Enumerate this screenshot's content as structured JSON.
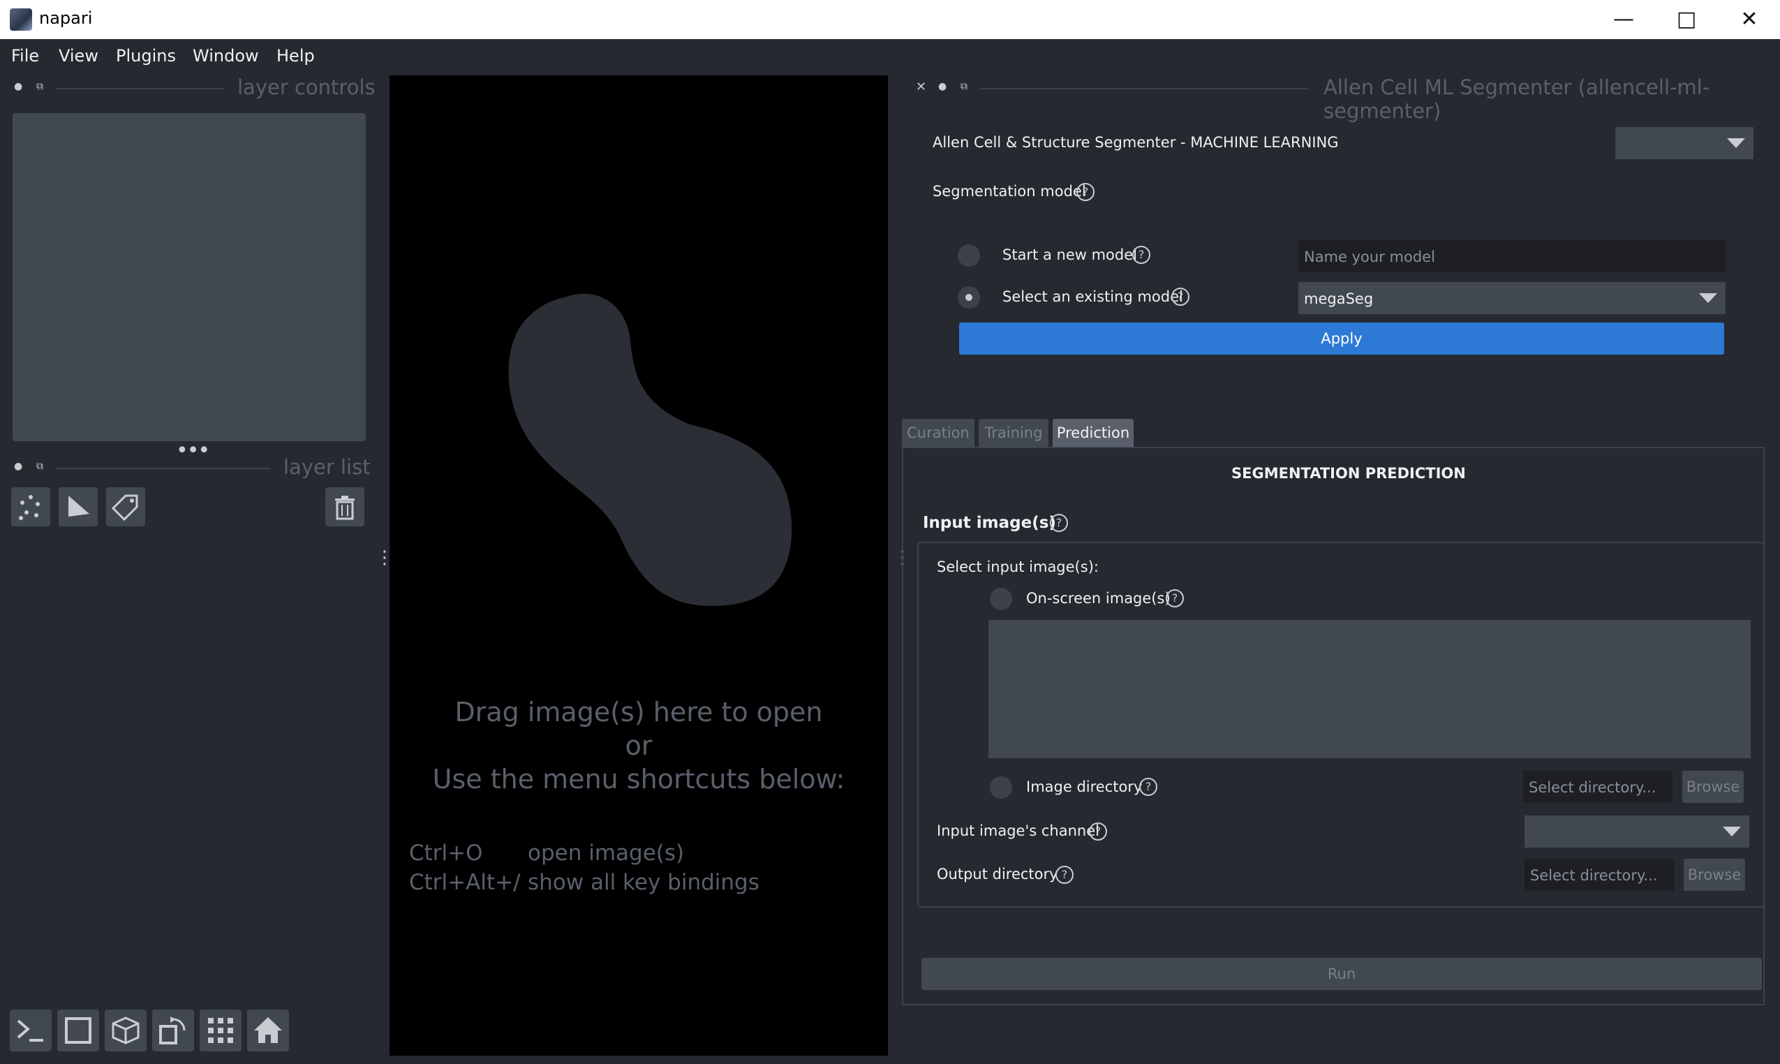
{
  "window": {
    "title": "napari",
    "minimize_icon": "minimize-icon",
    "maximize_icon": "maximize-icon",
    "close_icon": "close-icon"
  },
  "menu": [
    "File",
    "View",
    "Plugins",
    "Window",
    "Help"
  ],
  "left_dock": {
    "layer_controls_title": "layer controls",
    "layer_list_title": "layer list",
    "splitter_dots": "•••",
    "tools": [
      "points-icon",
      "shapes-icon",
      "labels-icon"
    ],
    "delete_icon": "trash-icon",
    "bottom_buttons": [
      "console-icon",
      "2d-view-icon",
      "3d-view-icon",
      "roll-icon",
      "grid-icon",
      "home-icon"
    ]
  },
  "canvas": {
    "line1": "Drag image(s) here to open",
    "line2": "or",
    "line3": "Use the menu shortcuts below:",
    "shortcuts": [
      {
        "keys": "Ctrl+O",
        "action": "open image(s)"
      },
      {
        "keys": "Ctrl+Alt+/",
        "action": "show all key bindings"
      }
    ]
  },
  "plugin": {
    "title": "Allen Cell ML Segmenter (allencell-ml-segmenter)",
    "header_label": "Allen Cell & Structure Segmenter - MACHINE LEARNING",
    "header_select_value": "",
    "segmentation_model_label": "Segmentation model",
    "help_glyph": "?",
    "start_new_label": "Start a new model",
    "name_placeholder": "Name your model",
    "select_existing_label": "Select an existing model",
    "existing_model_value": "megaSeg",
    "apply_label": "Apply",
    "tabs": [
      "Curation",
      "Training",
      "Prediction"
    ],
    "active_tab": "Prediction",
    "section_title": "SEGMENTATION PREDICTION",
    "input_images_label": "Input image(s)",
    "select_input_label": "Select input image(s):",
    "onscreen_label": "On-screen image(s)",
    "image_directory_label": "Image directory",
    "select_directory_placeholder": "Select directory...",
    "browse_label": "Browse",
    "channel_label": "Input image's channel",
    "channel_value": "",
    "output_directory_label": "Output directory",
    "run_label": "Run"
  },
  "colors": {
    "background": "#262930",
    "canvas": "#000000",
    "accent": "#2d7ad6",
    "panel": "#414851"
  }
}
